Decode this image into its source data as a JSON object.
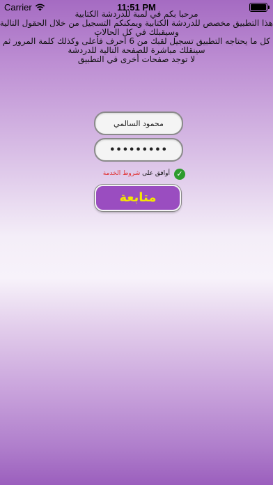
{
  "status_bar": {
    "carrier": "Carrier",
    "time": "11:51 PM"
  },
  "intro": {
    "lines": [
      "مرحبا بكم في لمبة للدردشة الكتابية",
      "هذا التطبيق مخصص للدردشة الكتابية ويمكنكم التسجيل من خلال الحقول التالية",
      "وسيقبلك في كل الحالات",
      "كل ما يحتاجه التطبيق تسجيل لقبك من 6 أحرف فأعلى وكذلك كلمة المرور ثم",
      "سينقلك مباشرة للصفحة التالية للدردشة",
      "لا توجد صفحات أخرى في التطبيق"
    ]
  },
  "form": {
    "username_value": "محمود السالمي",
    "password_value": "•••••••••",
    "terms_prefix": "أوافق على ",
    "terms_link": "شروط الخدمة",
    "continue_label": "متابعة"
  },
  "colors": {
    "button_bg": "#9a4dc0",
    "button_text": "#f4e800",
    "check_green": "#2e9b2e",
    "link_red": "#e03030"
  }
}
